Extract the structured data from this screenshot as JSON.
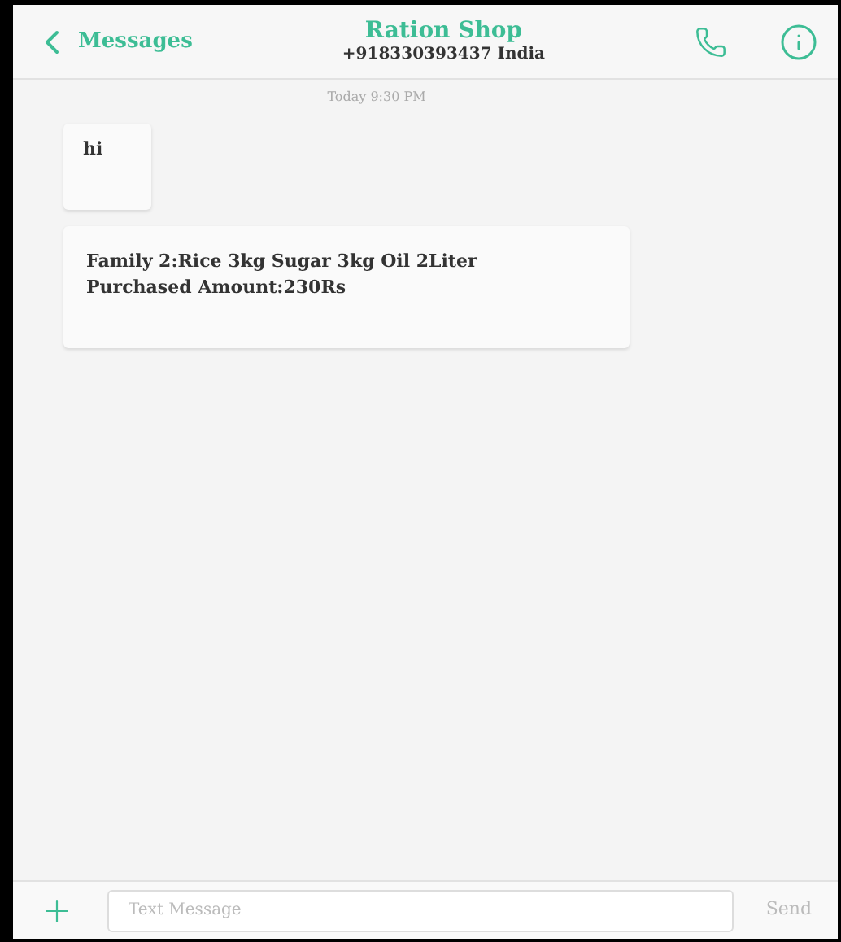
{
  "header": {
    "back_label": "Messages",
    "contact_name": "Ration Shop",
    "contact_number": "+918330393437 India"
  },
  "timestamp": "Today 9:30 PM",
  "messages": [
    {
      "text": "hi"
    },
    {
      "text": "Family 2:Rice 3kg Sugar 3kg Oil 2Liter\nPurchased Amount:230Rs"
    }
  ],
  "composer": {
    "placeholder": "Text Message",
    "send_label": "Send",
    "send_disabled": true
  }
}
